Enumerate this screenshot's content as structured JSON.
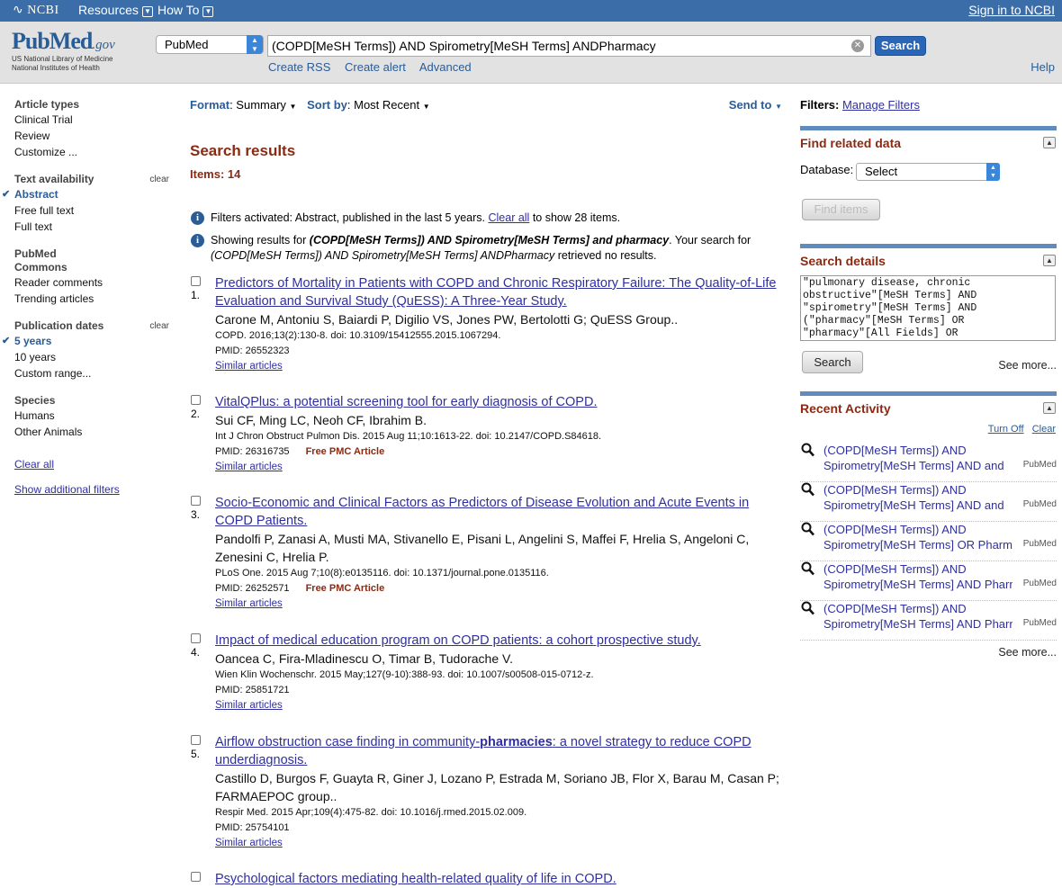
{
  "topbar": {
    "logo": "NCBI",
    "resources": "Resources",
    "how_to": "How To",
    "sign_in": "Sign in to NCBI"
  },
  "header": {
    "logo_main": "PubMed",
    "logo_gov": ".gov",
    "logo_line1": "US National Library of Medicine",
    "logo_line2": "National Institutes of Health",
    "db_select": "PubMed",
    "query": "(COPD[MeSH Terms]) AND Spirometry[MeSH Terms] ANDPharmacy",
    "search_button": "Search",
    "links": [
      "Create RSS",
      "Create alert",
      "Advanced"
    ],
    "help": "Help"
  },
  "sidebar": {
    "groups": [
      {
        "title": "Article types",
        "clear": "",
        "items": [
          {
            "label": "Clinical Trial",
            "active": false
          },
          {
            "label": "Review",
            "active": false
          },
          {
            "label": "Customize ...",
            "active": false
          }
        ]
      },
      {
        "title": "Text availability",
        "clear": "clear",
        "items": [
          {
            "label": "Abstract",
            "active": true
          },
          {
            "label": "Free full text",
            "active": false
          },
          {
            "label": "Full text",
            "active": false
          }
        ]
      },
      {
        "title": "PubMed\nCommons",
        "clear": "",
        "items": [
          {
            "label": "Reader comments",
            "active": false
          },
          {
            "label": "Trending articles",
            "active": false
          }
        ]
      },
      {
        "title": "Publication dates",
        "clear": "clear",
        "items": [
          {
            "label": "5 years",
            "active": true
          },
          {
            "label": "10 years",
            "active": false
          },
          {
            "label": "Custom range...",
            "active": false
          }
        ]
      },
      {
        "title": "Species",
        "clear": "",
        "items": [
          {
            "label": "Humans",
            "active": false
          },
          {
            "label": "Other Animals",
            "active": false
          }
        ]
      }
    ],
    "clear_all": "Clear all",
    "show_filters": "Show additional filters"
  },
  "main": {
    "format_label": "Format",
    "format_value": "Summary",
    "sort_label": "Sort by",
    "sort_value": "Most Recent",
    "send_to": "Send to",
    "heading": "Search results",
    "items_label": "Items: 14",
    "info1_a": "Filters activated: Abstract, published in the last 5 years. ",
    "info1_link": "Clear all",
    "info1_b": " to show 28 items.",
    "info2_a": "Showing results for ",
    "info2_em": "(COPD[MeSH Terms]) AND Spirometry[MeSH Terms] and pharmacy",
    "info2_b": ". Your search for ",
    "info2_em2": "(COPD[MeSH Terms]) AND Spirometry[MeSH Terms] ANDPharmacy",
    "info2_c": " retrieved no results.",
    "results": [
      {
        "num": "1.",
        "title": "Predictors of Mortality in Patients with COPD and Chronic Respiratory Failure: The Quality-of-Life Evaluation and Survival Study (QuESS): A Three-Year Study.",
        "authors": "Carone M, Antoniu S, Baiardi P, Digilio VS, Jones PW, Bertolotti G; QuESS Group..",
        "journal": "COPD. 2016;13(2):130-8. doi: 10.3109/15412555.2015.1067294.",
        "pmid": "PMID: 26552323",
        "free": "",
        "similar": "Similar articles"
      },
      {
        "num": "2.",
        "title": "VitalQPlus: a potential screening tool for early diagnosis of COPD.",
        "authors": "Sui CF, Ming LC, Neoh CF, Ibrahim B.",
        "journal": "Int J Chron Obstruct Pulmon Dis. 2015 Aug 11;10:1613-22. doi: 10.2147/COPD.S84618.",
        "pmid": "PMID: 26316735",
        "free": "Free PMC Article",
        "similar": "Similar articles"
      },
      {
        "num": "3.",
        "title": "Socio-Economic and Clinical Factors as Predictors of Disease Evolution and Acute Events in COPD Patients.",
        "authors": "Pandolfi P, Zanasi A, Musti MA, Stivanello E, Pisani L, Angelini S, Maffei F, Hrelia S, Angeloni C, Zenesini C, Hrelia P.",
        "journal": "PLoS One. 2015 Aug 7;10(8):e0135116. doi: 10.1371/journal.pone.0135116.",
        "pmid": "PMID: 26252571",
        "free": "Free PMC Article",
        "similar": "Similar articles"
      },
      {
        "num": "4.",
        "title": "Impact of medical education program on COPD patients: a cohort prospective study.",
        "authors": "Oancea C, Fira-Mladinescu O, Timar B, Tudorache V.",
        "journal": "Wien Klin Wochenschr. 2015 May;127(9-10):388-93. doi: 10.1007/s00508-015-0712-z.",
        "pmid": "PMID: 25851721",
        "free": "",
        "similar": "Similar articles"
      },
      {
        "num": "5.",
        "title_a": "Airflow obstruction case finding in community-",
        "title_bold": "pharmacies",
        "title_b": ": a novel strategy to reduce COPD underdiagnosis.",
        "authors": "Castillo D, Burgos F, Guayta R, Giner J, Lozano P, Estrada M, Soriano JB, Flor X, Barau M, Casan P; FARMAEPOC group..",
        "journal": "Respir Med. 2015 Apr;109(4):475-82. doi: 10.1016/j.rmed.2015.02.009.",
        "pmid": "PMID: 25754101",
        "free": "",
        "similar": "Similar articles"
      },
      {
        "num": "6.",
        "title": "Psychological factors mediating health-related quality of life in COPD."
      }
    ]
  },
  "right": {
    "filters_label": "Filters:",
    "manage": "Manage Filters",
    "related_title": "Find related data",
    "database_label": "Database:",
    "database_value": "Select",
    "find_items": "Find items",
    "details_title": "Search details",
    "details_text": "\"pulmonary disease, chronic\nobstructive\"[MeSH Terms] AND\n\"spirometry\"[MeSH Terms] AND\n(\"pharmacy\"[MeSH Terms] OR\n\"pharmacy\"[All Fields] OR",
    "details_search": "Search",
    "see_more": "See more...",
    "activity_title": "Recent Activity",
    "turn_off": "Turn Off",
    "clear": "Clear",
    "activity": [
      {
        "l1": "(COPD[MeSH Terms]) AND",
        "l2": "Spirometry[MeSH Terms] AND and",
        "db": "PubMed"
      },
      {
        "l1": "(COPD[MeSH Terms]) AND",
        "l2": "Spirometry[MeSH Terms] AND and",
        "db": "PubMed"
      },
      {
        "l1": "(COPD[MeSH Terms]) AND",
        "l2": "Spirometry[MeSH Terms] OR Pharma",
        "db": "PubMed"
      },
      {
        "l1": "(COPD[MeSH Terms]) AND",
        "l2": "Spirometry[MeSH Terms] AND Pharm",
        "db": "PubMed"
      },
      {
        "l1": "(COPD[MeSH Terms]) AND",
        "l2": "Spirometry[MeSH Terms] AND Pharm",
        "db": "PubMed"
      }
    ],
    "see_more2": "See more..."
  },
  "colors": {
    "topbar": "#3b6ea8",
    "brand": "#2a5c96",
    "heading": "#8b2a12",
    "link": "#2f2f9f"
  },
  "icons": [
    "ncbi-logo-icon",
    "chevron-down-icon",
    "clear-search-icon",
    "info-icon",
    "checkbox-icon",
    "search-magnifier-icon",
    "collapse-toggle-icon"
  ]
}
